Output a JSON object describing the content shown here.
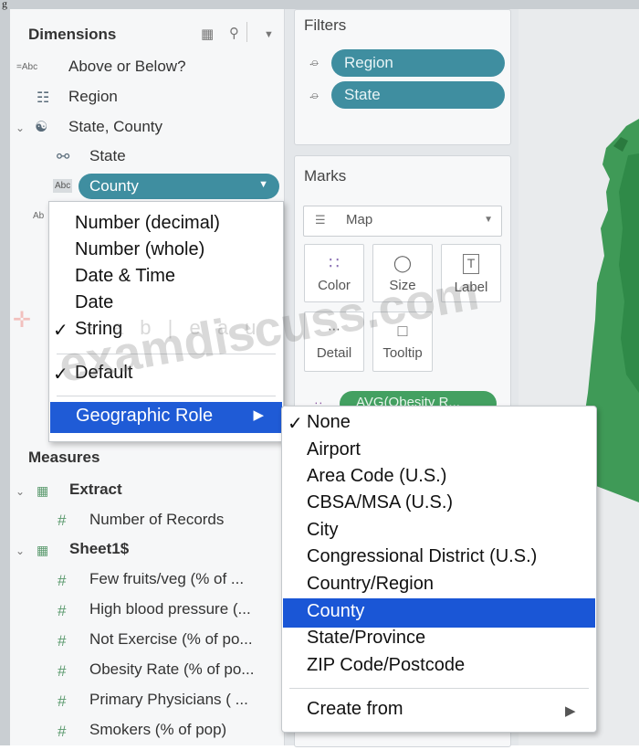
{
  "caption": "g",
  "data_pane": {
    "dimensions_title": "Dimensions",
    "dimension_fields": [
      {
        "type_icon": "=Abc",
        "label": "Above or Below?"
      },
      {
        "type_icon": "geo",
        "label": "Region"
      },
      {
        "type_icon": "hierarchy",
        "label": "State, County"
      },
      {
        "type_icon": "globe",
        "label": "State"
      },
      {
        "type_icon": "Abc",
        "label": "County"
      }
    ],
    "peek_abc": "Ab",
    "measures_title": "Measures",
    "extract_label": "Extract",
    "number_of_records": "Number of Records",
    "sheet_label": "Sheet1$",
    "measure_fields": [
      "Few fruits/veg (% of ...",
      "High blood pressure (...",
      "Not Exercise (% of po...",
      "Obesity Rate (% of po...",
      "Primary Physicians ( ...",
      "Smokers (% of pop)"
    ]
  },
  "filters": {
    "title": "Filters",
    "pills": [
      "Region",
      "State"
    ]
  },
  "marks": {
    "title": "Marks",
    "mark_type": "Map",
    "buttons": [
      "Color",
      "Size",
      "Label",
      "Detail",
      "Tooltip"
    ],
    "partial_pill": "AVG(Obesity R..."
  },
  "context_menu": {
    "items": [
      "Number (decimal)",
      "Number (whole)",
      "Date & Time",
      "Date",
      "String"
    ],
    "default_label": "Default",
    "geographic_role": "Geographic Role",
    "checked_item": "String"
  },
  "geo_submenu": {
    "items": [
      "None",
      "Airport",
      "Area Code (U.S.)",
      "CBSA/MSA (U.S.)",
      "City",
      "Congressional District (U.S.)",
      "Country/Region",
      "County",
      "State/Province",
      "ZIP Code/Postcode"
    ],
    "create_from": "Create from",
    "checked": "None",
    "highlighted": "County"
  },
  "watermarks": {
    "tableau": "+ a b | e a u",
    "site": "examdiscuss.com"
  },
  "colors": {
    "pill": "#3f8ea0",
    "highlight": "#1a56d6",
    "map_green": "#3f9a57"
  }
}
